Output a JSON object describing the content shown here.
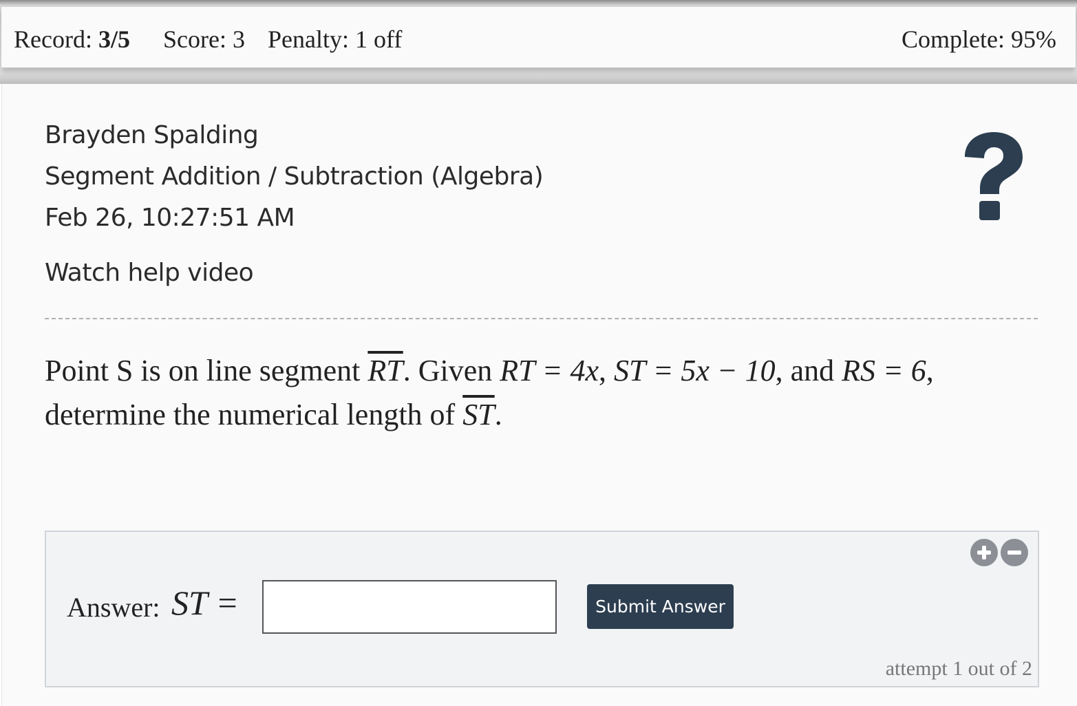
{
  "status_bar": {
    "record_label": "Record: ",
    "record_value": "3/5",
    "score_text": "Score: 3",
    "penalty_text": "Penalty: 1 off",
    "complete_text": "Complete: 95%"
  },
  "header": {
    "student_name": "Brayden Spalding",
    "lesson_title": "Segment Addition / Subtraction (Algebra)",
    "timestamp": "Feb 26, 10:27:51 AM",
    "help_video_link": "Watch help video",
    "help_icon": "question-mark-icon",
    "icon_color": "#2c3e50"
  },
  "problem": {
    "t1": "Point S is on line segment ",
    "seg_rt": "RT",
    "t2": ". Given ",
    "eq_rt": "RT = 4x",
    "t3": ", ",
    "eq_st": "ST = 5x − 10",
    "t4": ", and ",
    "eq_rs": "RS = 6",
    "t5": ", determine the numerical length of ",
    "seg_st": "ST",
    "t6": "."
  },
  "answer": {
    "label": "Answer:",
    "variable": "ST =",
    "input_value": "",
    "submit_label": "Submit Answer",
    "attempt_text": "attempt 1 out of 2",
    "zoom_in_icon": "plus-circle-icon",
    "zoom_out_icon": "minus-circle-icon",
    "submit_color": "#2c3e50"
  }
}
